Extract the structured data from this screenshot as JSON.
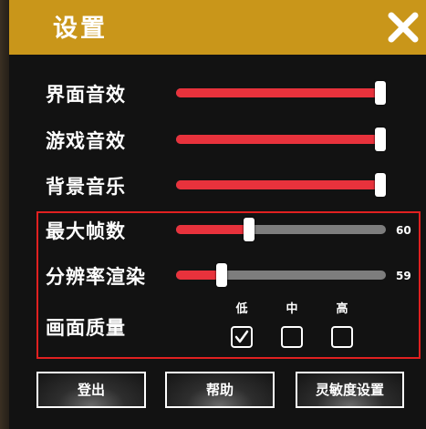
{
  "title": "设置",
  "close_icon": "close-icon",
  "colors": {
    "title_bar": "#c9961a",
    "slider_fill": "#e8323c",
    "slider_track": "#7d7d7d",
    "highlight_box": "#e02020"
  },
  "sliders": [
    {
      "label": "界面音效",
      "value": 1.0
    },
    {
      "label": "游戏音效",
      "value": 1.0
    },
    {
      "label": "背景音乐",
      "value": 1.0
    },
    {
      "label": "最大帧数",
      "value": 0.34,
      "display": "60"
    },
    {
      "label": "分辨率渲染",
      "value": 0.2,
      "display": "59"
    }
  ],
  "quality": {
    "label": "画面质量",
    "options": [
      {
        "label": "低",
        "checked": true
      },
      {
        "label": "中",
        "checked": false
      },
      {
        "label": "高",
        "checked": false
      }
    ]
  },
  "buttons": {
    "logout": "登出",
    "help": "帮助",
    "sensitivity": "灵敏度设置"
  }
}
